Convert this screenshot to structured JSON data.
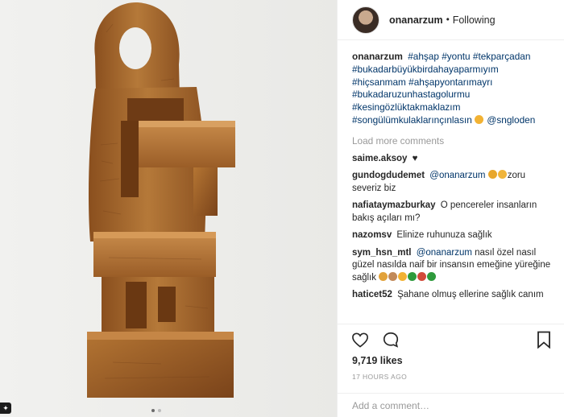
{
  "post": {
    "image_alt_icon": "wooden-sculpture-photo",
    "carousel_dots": 2,
    "carousel_active": 1
  },
  "header": {
    "username": "onanarzum",
    "separator": "•",
    "follow_label": "Following"
  },
  "caption": {
    "username": "onanarzum",
    "lines": [
      "#ahşap #yontu #tekparçadan",
      "#bukadarbüyükbirdahayaparmıyım",
      "#hiçsanmam #ahşapyontarımayrı",
      "#bukadaruzunhastagolurmu",
      "#kesingözlüktakmaklazım",
      "#songülümkulaklarınçınlasın",
      "@sngloden"
    ]
  },
  "load_more": "Load more comments",
  "comments": [
    {
      "user": "saime.aksoy",
      "text": "♥"
    },
    {
      "user": "gundogdudemet",
      "mention": "@onanarzum",
      "text": "zoru severiz biz"
    },
    {
      "user": "nafiataymazburkay",
      "text": "O pencereler insanların bakış açıları mı?"
    },
    {
      "user": "nazomsv",
      "text": "Elinize ruhunuza sağlık"
    },
    {
      "user": "sym_hsn_mtl",
      "mention": "@onanarzum",
      "text": "nasıl özel nasıl güzel nasılda naif bir insansın emeğine yüreğine sağlık"
    },
    {
      "user": "haticet52",
      "text": "Şahane olmuş ellerine sağlık canım"
    }
  ],
  "actions": {
    "like_icon": "heart-icon",
    "comment_icon": "speech-bubble-icon",
    "save_icon": "bookmark-icon"
  },
  "likes": "9,719 likes",
  "time_ago": "17 HOURS AGO",
  "add_comment_placeholder": "Add a comment…",
  "colors": {
    "hashtag": "#003569",
    "muted": "#999999",
    "text": "#262626",
    "wood": "#a8692f"
  }
}
